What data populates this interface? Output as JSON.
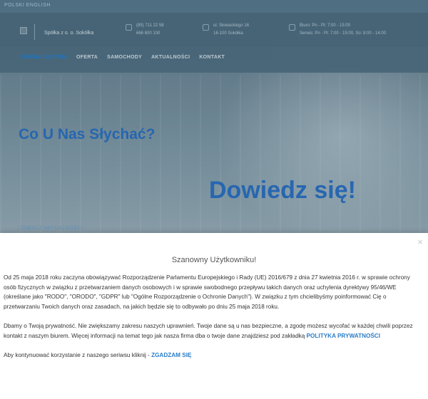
{
  "topbar": {
    "languages": "POLSKI  ENGLISH"
  },
  "header": {
    "company": "Spółka z o. o. Sokółka",
    "contact_phone": [
      "(85) 711 22 58",
      "666 800 100"
    ],
    "contact_address": [
      "ul. Słowackiego 16",
      "16-100 Sokółka"
    ],
    "contact_hours": [
      "Biuro: Pn - Pt: 7:00 - 15:00",
      "Serwis: Pn - Pt: 7:00 - 15:00, So: 8:00 - 14:00"
    ]
  },
  "nav": {
    "items": [
      "STRONA GŁÓWNA",
      "OFERTA",
      "SAMOCHODY",
      "AKTUALNOŚCI",
      "KONTAKT"
    ]
  },
  "hero": {
    "title": "Co U Nas Słychać?",
    "cta_big": "Dowiedz się!",
    "link": "ZOBACZ AKTUALNOŚCI"
  },
  "modal": {
    "close_label": "×",
    "title": "Szanowny Użytkowniku!",
    "p1": "Od 25 maja 2018 roku zaczyna obowiązywać Rozporządzenie Parlamentu Europejskiego i Rady (UE) 2016/679 z dnia 27 kwietnia 2016 r. w sprawie ochrony osób fizycznych w związku z przetwarzaniem danych osobowych i w sprawie swobodnego przepływu takich danych oraz uchylenia dyrektywy 95/46/WE (określane jako \"RODO\", \"ORODO\", \"GDPR\" lub \"Ogólne Rozporządzenie o Ochronie Danych\"). W związku z tym chcielibyśmy poinformować Cię o przetwarzaniu Twoich danych oraz zasadach, na jakich będzie się to odbywało po dniu 25 maja 2018 roku.",
    "p2_text": "Dbamy o Twoją prywatność. Nie zwiększamy zakresu naszych uprawnień. Twoje dane są u nas bezpieczne, a zgodę możesz wycofać w każdej chwili poprzez kontakt z naszym biurem. Więcej informacji na temat tego jak nasza firma dba o twoje dane znajdziesz pod zakładką ",
    "p2_link": "POLITYKA PRYWATNOŚCI",
    "p3_text": "Aby kontynuować korzystanie z naszego seriwsu kliknij - ",
    "p3_link": "ZGADZAM SIĘ"
  }
}
